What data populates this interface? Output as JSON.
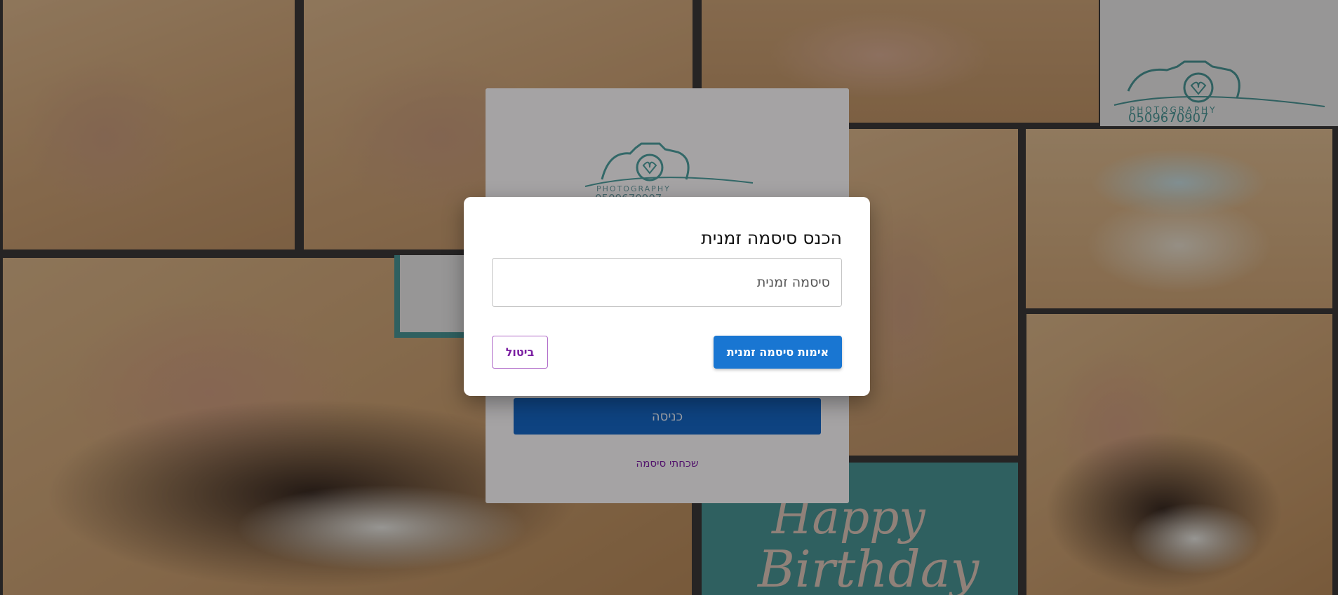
{
  "background": {
    "watermark_phone": "0509670907",
    "watermark_brand": "PHOTOGRAPHY",
    "banner_text_line1": "Happy",
    "banner_text_line2": "Birthday"
  },
  "login_card": {
    "logo_phone": "0509670907",
    "logo_tagline": "PHOTOGRAPHY",
    "login_button_label": "כניסה",
    "forgot_password_label": "שכחתי סיסמה"
  },
  "dialog": {
    "title": "הכנס סיסמה זמנית",
    "input_placeholder": "סיסמה זמנית",
    "input_value": "",
    "verify_button_label": "אימות סיסמה זמנית",
    "cancel_button_label": "ביטול"
  },
  "colors": {
    "primary": "#1976d2",
    "secondary": "#7b1fa2",
    "teal": "#4d9c9c"
  }
}
